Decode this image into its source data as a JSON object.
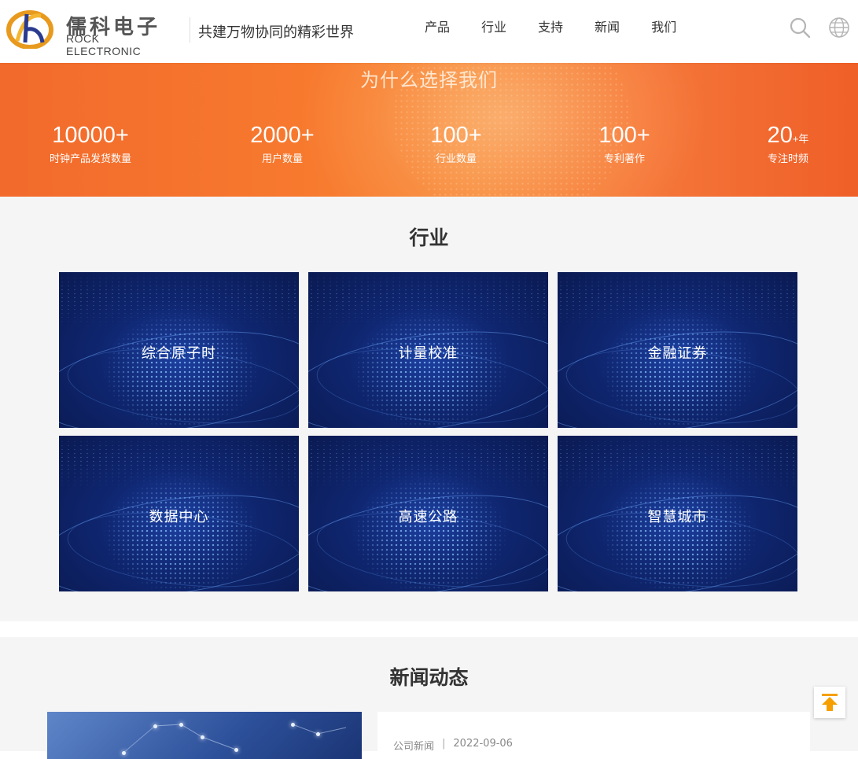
{
  "header": {
    "logo_cn": "儒科电子",
    "logo_en": "ROCK ELECTRONIC",
    "slogan": "共建万物协同的精彩世界",
    "nav": [
      "产品",
      "行业",
      "支持",
      "新闻",
      "我们"
    ],
    "search_icon": "search-icon",
    "language_icon": "globe-icon"
  },
  "banner": {
    "title": "为什么选择我们",
    "stats": [
      {
        "value": "10000+",
        "suffix": "",
        "label": "时钟产品发货数量"
      },
      {
        "value": "2000+",
        "suffix": "",
        "label": "用户数量"
      },
      {
        "value": "100+",
        "suffix": "",
        "label": "行业数量"
      },
      {
        "value": "100+",
        "suffix": "",
        "label": "专利著作"
      },
      {
        "value": "20",
        "suffix": "+年",
        "label": "专注时频"
      }
    ]
  },
  "industry": {
    "title": "行业",
    "cards": [
      "综合原子时",
      "计量校准",
      "金融证券",
      "数据中心",
      "高速公路",
      "智慧城市"
    ]
  },
  "news": {
    "title": "新闻动态",
    "items": [
      {
        "category": "公司新闻",
        "separator": "|",
        "date": "2022-09-06"
      }
    ]
  },
  "colors": {
    "accent": "#f26a2c",
    "card_bg": "#0f2670",
    "back_top_arrow": "#f5a000"
  },
  "back_to_top_icon": "arrow-up-icon"
}
